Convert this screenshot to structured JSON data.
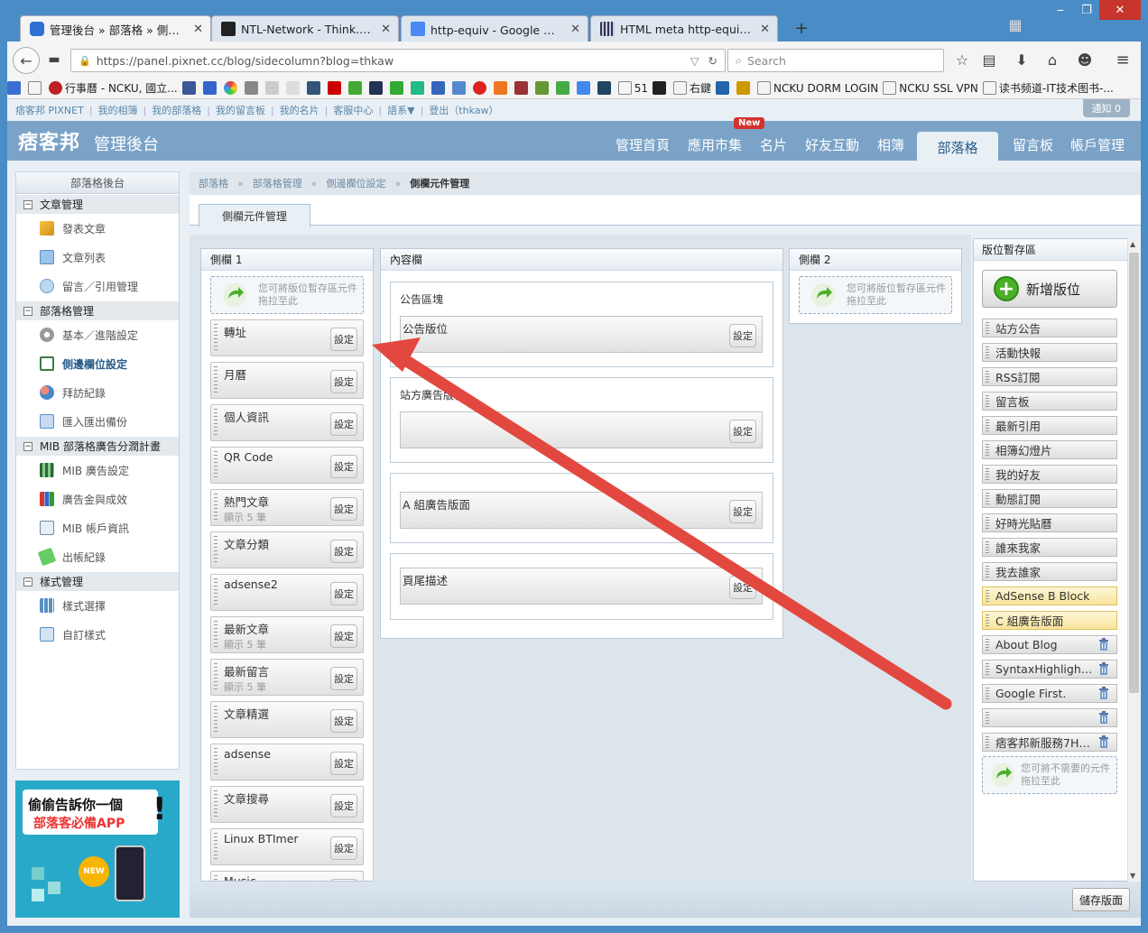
{
  "browser": {
    "tabs": [
      {
        "title": "管理後台 » 部落格 » 側邊...",
        "active": true
      },
      {
        "title": "NTL-Network - Think. Ev...",
        "active": false
      },
      {
        "title": "http-equiv - Google 搜尋",
        "active": false
      },
      {
        "title": "HTML meta http-equiv ...",
        "active": false
      }
    ],
    "url": "https://panel.pixnet.cc/blog/sidecolumn?blog=thkaw",
    "search_placeholder": "Search",
    "bookmarks": [
      "行事曆 - NCKU, 國立...",
      "51",
      "右鍵",
      "NCKU DORM LOGIN",
      "NCKU SSL VPN",
      "读书频道-IT技术图书-..."
    ]
  },
  "pixnet": {
    "toplinks": [
      "痞客邦 PIXNET",
      "我的相簿",
      "我的部落格",
      "我的留言板",
      "我的名片",
      "客服中心",
      "語系▼",
      "登出（thkaw）"
    ],
    "notify": "通知 0",
    "logo": "痞客邦",
    "admin_title": "管理後台",
    "nav": [
      "管理首頁",
      "應用市集",
      "名片",
      "好友互動",
      "相簿",
      "部落格",
      "留言板",
      "帳戶管理"
    ],
    "new_badge": "New",
    "active_nav": "部落格"
  },
  "sidebar": {
    "header": "部落格後台",
    "groups": [
      {
        "title": "文章管理",
        "items": [
          "發表文章",
          "文章列表",
          "留言／引用管理"
        ]
      },
      {
        "title": "部落格管理",
        "items": [
          "基本／進階設定",
          "側邊欄位設定",
          "拜訪紀錄",
          "匯入匯出備份"
        ]
      },
      {
        "title": "MIB 部落格廣告分潤計畫",
        "items": [
          "MIB 廣告設定",
          "廣告金與成效",
          "MIB 帳戶資訊",
          "出帳紀錄"
        ]
      },
      {
        "title": "樣式管理",
        "items": [
          "樣式選擇",
          "自訂樣式"
        ]
      }
    ],
    "active_item": "側邊欄位設定",
    "ad_text": [
      "偷偷告訴你一個",
      "部落客必備APP"
    ]
  },
  "breadcrumb": [
    "部落格",
    "部落格管理",
    "側邊欄位設定",
    "側欄元件管理"
  ],
  "page_tab": "側欄元件管理",
  "columns": {
    "col1": {
      "title": "側欄 1",
      "dropzone": "您可將版位暫存區元件拖拉至此",
      "widgets": [
        {
          "title": "轉址",
          "sub": ""
        },
        {
          "title": "月曆",
          "sub": ""
        },
        {
          "title": "個人資訊",
          "sub": ""
        },
        {
          "title": "QR Code",
          "sub": ""
        },
        {
          "title": "熱門文章",
          "sub": "顯示 5 筆"
        },
        {
          "title": "文章分類",
          "sub": ""
        },
        {
          "title": "adsense2",
          "sub": ""
        },
        {
          "title": "最新文章",
          "sub": "顯示 5 筆"
        },
        {
          "title": "最新留言",
          "sub": "顯示 5 筆"
        },
        {
          "title": "文章精選",
          "sub": ""
        },
        {
          "title": "adsense",
          "sub": ""
        },
        {
          "title": "文章搜尋",
          "sub": ""
        },
        {
          "title": "Linux BTImer",
          "sub": ""
        },
        {
          "title": "Music",
          "sub": ""
        }
      ]
    },
    "content": {
      "title": "內容欄",
      "regions": [
        {
          "title": "公告區塊",
          "widget": "公告版位"
        },
        {
          "title": "站方廣告版位",
          "widget": ""
        },
        {
          "title": "",
          "widget": "A 組廣告版面"
        },
        {
          "title": "",
          "widget": "頁尾描述"
        }
      ]
    },
    "col2": {
      "title": "側欄 2",
      "dropzone": "您可將版位暫存區元件拖拉至此"
    }
  },
  "set_label": "設定",
  "staging": {
    "title": "版位暫存區",
    "new_button": "新增版位",
    "items": [
      {
        "label": "站方公告",
        "style": "gray",
        "trash": false
      },
      {
        "label": "活動快報",
        "style": "gray",
        "trash": false
      },
      {
        "label": "RSS訂閱",
        "style": "gray",
        "trash": false
      },
      {
        "label": "留言板",
        "style": "gray",
        "trash": false
      },
      {
        "label": "最新引用",
        "style": "gray",
        "trash": false
      },
      {
        "label": "相簿幻燈片",
        "style": "gray",
        "trash": false
      },
      {
        "label": "我的好友",
        "style": "gray",
        "trash": false
      },
      {
        "label": "動態訂閱",
        "style": "gray",
        "trash": false
      },
      {
        "label": "好時光貼曆",
        "style": "gray",
        "trash": false
      },
      {
        "label": "誰來我家",
        "style": "gray",
        "trash": false
      },
      {
        "label": "我去誰家",
        "style": "gray",
        "trash": false
      },
      {
        "label": "AdSense B Block",
        "style": "yellow",
        "trash": false
      },
      {
        "label": "C 組廣告版面",
        "style": "yellow",
        "trash": false
      },
      {
        "label": "About Blog",
        "style": "gray",
        "trash": true
      },
      {
        "label": "SyntaxHighlight...",
        "style": "gray",
        "trash": true
      },
      {
        "label": "Google First.",
        "style": "gray",
        "trash": true
      },
      {
        "label": "",
        "style": "gray",
        "trash": true
      },
      {
        "label": "痞客邦新服務7He...",
        "style": "gray",
        "trash": true
      }
    ],
    "dropzone": "您可將不需要的元件拖拉至此"
  },
  "save_button": "儲存版面",
  "annotation_color": "#e2483f"
}
